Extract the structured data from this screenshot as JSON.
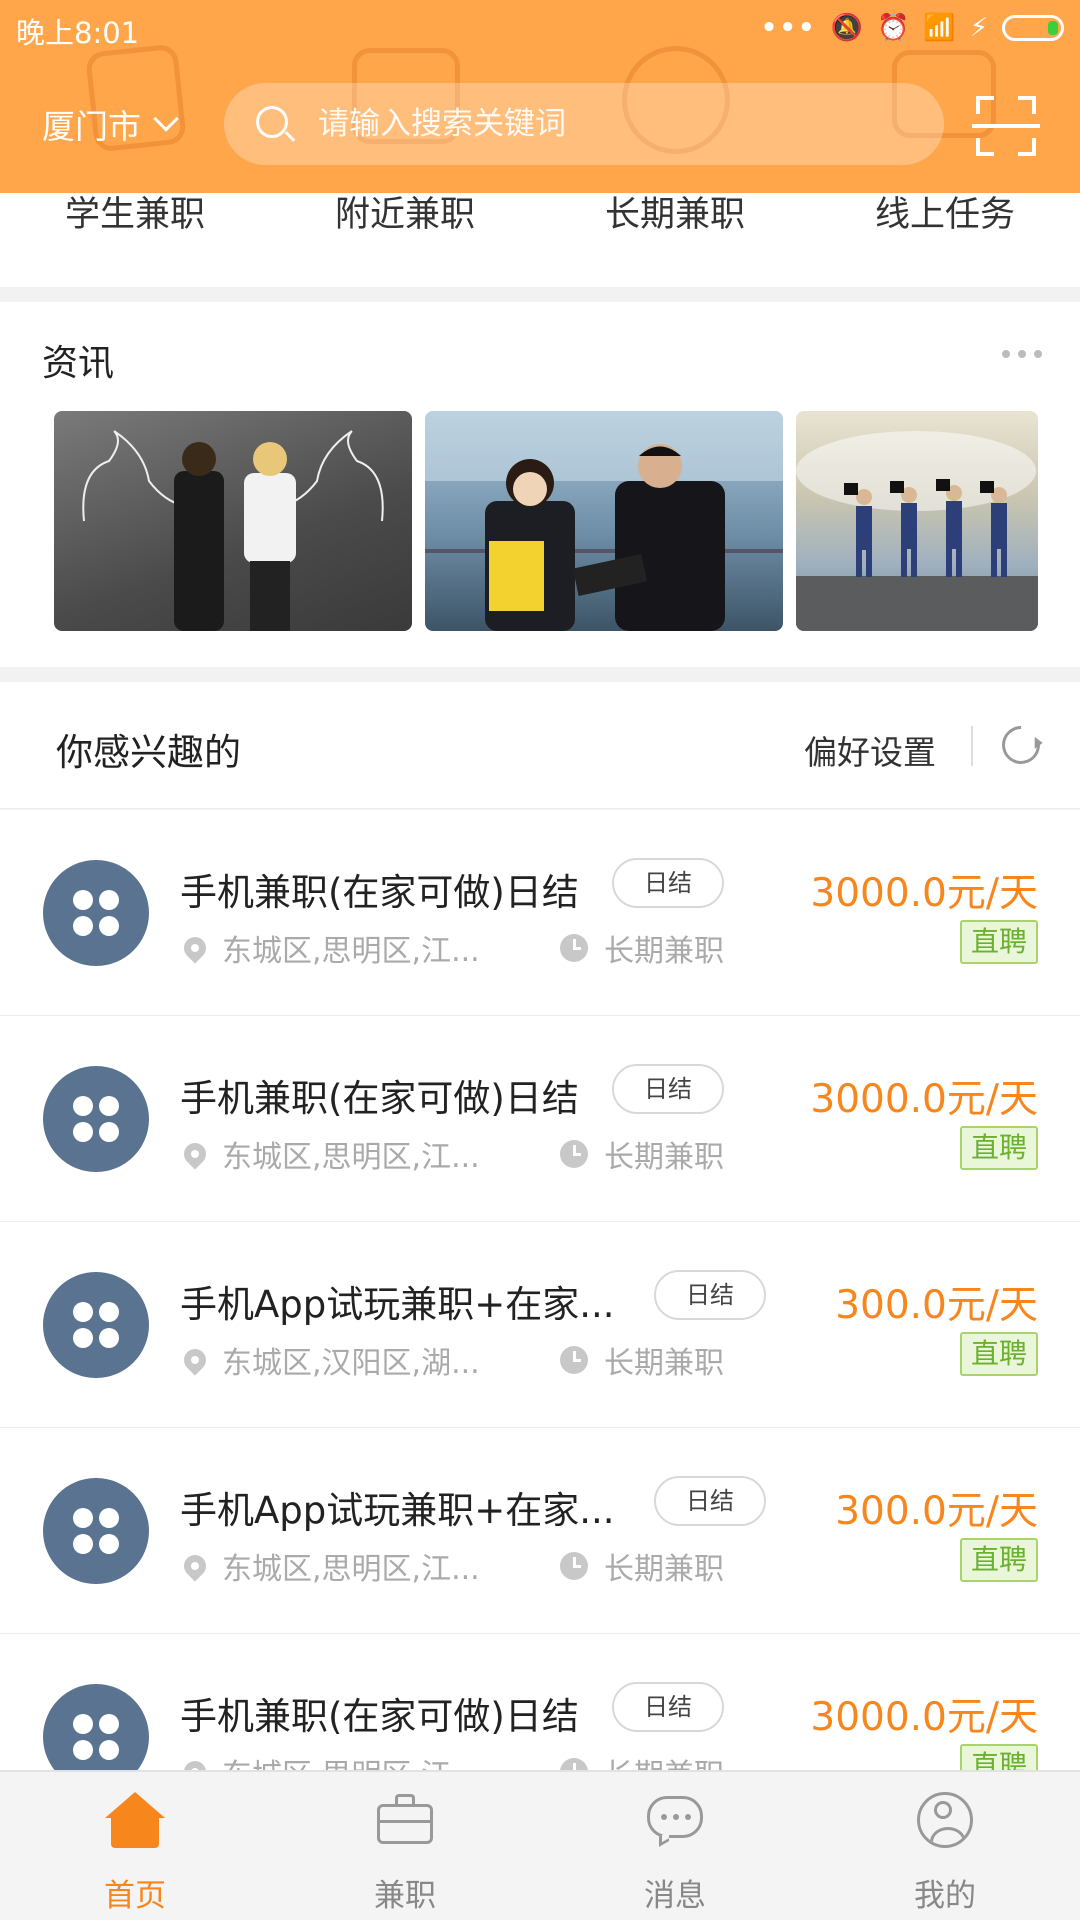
{
  "status_bar": {
    "time": "晚上8:01"
  },
  "header": {
    "city": "厦门市",
    "search_placeholder": "请输入搜索关键词"
  },
  "categories": [
    "学生兼职",
    "附近兼职",
    "长期兼职",
    "线上任务"
  ],
  "news": {
    "title": "资讯",
    "images": [
      {
        "name": "news-image-strength"
      },
      {
        "name": "news-image-business"
      },
      {
        "name": "news-image-team"
      }
    ]
  },
  "interest": {
    "title": "你感兴趣的",
    "pref_label": "偏好设置"
  },
  "jobs": [
    {
      "title": "手机兼职(在家可做)日结",
      "tag": "日结",
      "location": "东城区,思明区,江...",
      "duration": "长期兼职",
      "salary": "3000.0元/天",
      "badge": "直聘"
    },
    {
      "title": "手机兼职(在家可做)日结",
      "tag": "日结",
      "location": "东城区,思明区,江...",
      "duration": "长期兼职",
      "salary": "3000.0元/天",
      "badge": "直聘"
    },
    {
      "title": "手机App试玩兼职+在家...",
      "tag": "日结",
      "location": "东城区,汉阳区,湖...",
      "duration": "长期兼职",
      "salary": "300.0元/天",
      "badge": "直聘"
    },
    {
      "title": "手机App试玩兼职+在家...",
      "tag": "日结",
      "location": "东城区,思明区,江...",
      "duration": "长期兼职",
      "salary": "300.0元/天",
      "badge": "直聘"
    },
    {
      "title": "手机兼职(在家可做)日结",
      "tag": "日结",
      "location": "东城区,思明区,江...",
      "duration": "长期兼职",
      "salary": "3000.0元/天",
      "badge": "直聘"
    }
  ],
  "bottom_nav": [
    {
      "label": "首页",
      "icon": "home-icon",
      "active": true
    },
    {
      "label": "兼职",
      "icon": "briefcase-icon",
      "active": false
    },
    {
      "label": "消息",
      "icon": "message-icon",
      "active": false
    },
    {
      "label": "我的",
      "icon": "user-icon",
      "active": false
    }
  ],
  "colors": {
    "header_bg": "#ffa54a",
    "accent": "#f7861c",
    "avatar_bg": "#5a7390",
    "badge_green": "#6cb12e"
  }
}
